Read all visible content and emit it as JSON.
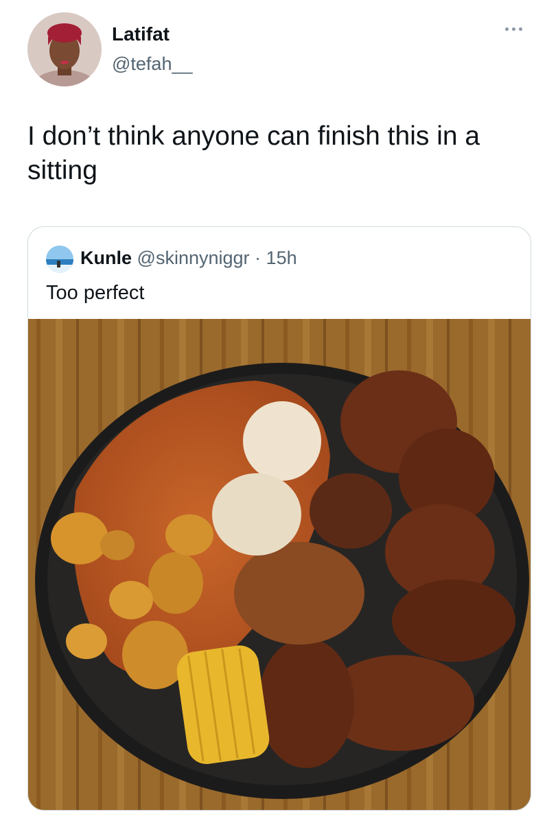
{
  "author": {
    "name": "Latifat",
    "handle": "@tefah__"
  },
  "tweet": {
    "text": "I don’t think anyone can finish this in a sitting"
  },
  "quote": {
    "name": "Kunle",
    "handle": "@skinnyniggr",
    "separator": "·",
    "time": "15h",
    "text": "Too perfect",
    "media": "food-photo"
  },
  "icons": {
    "more": "more-options-icon",
    "avatar": "avatar"
  },
  "colors": {
    "text": "#0f1419",
    "secondary": "#536471",
    "border": "#cfd9de"
  }
}
